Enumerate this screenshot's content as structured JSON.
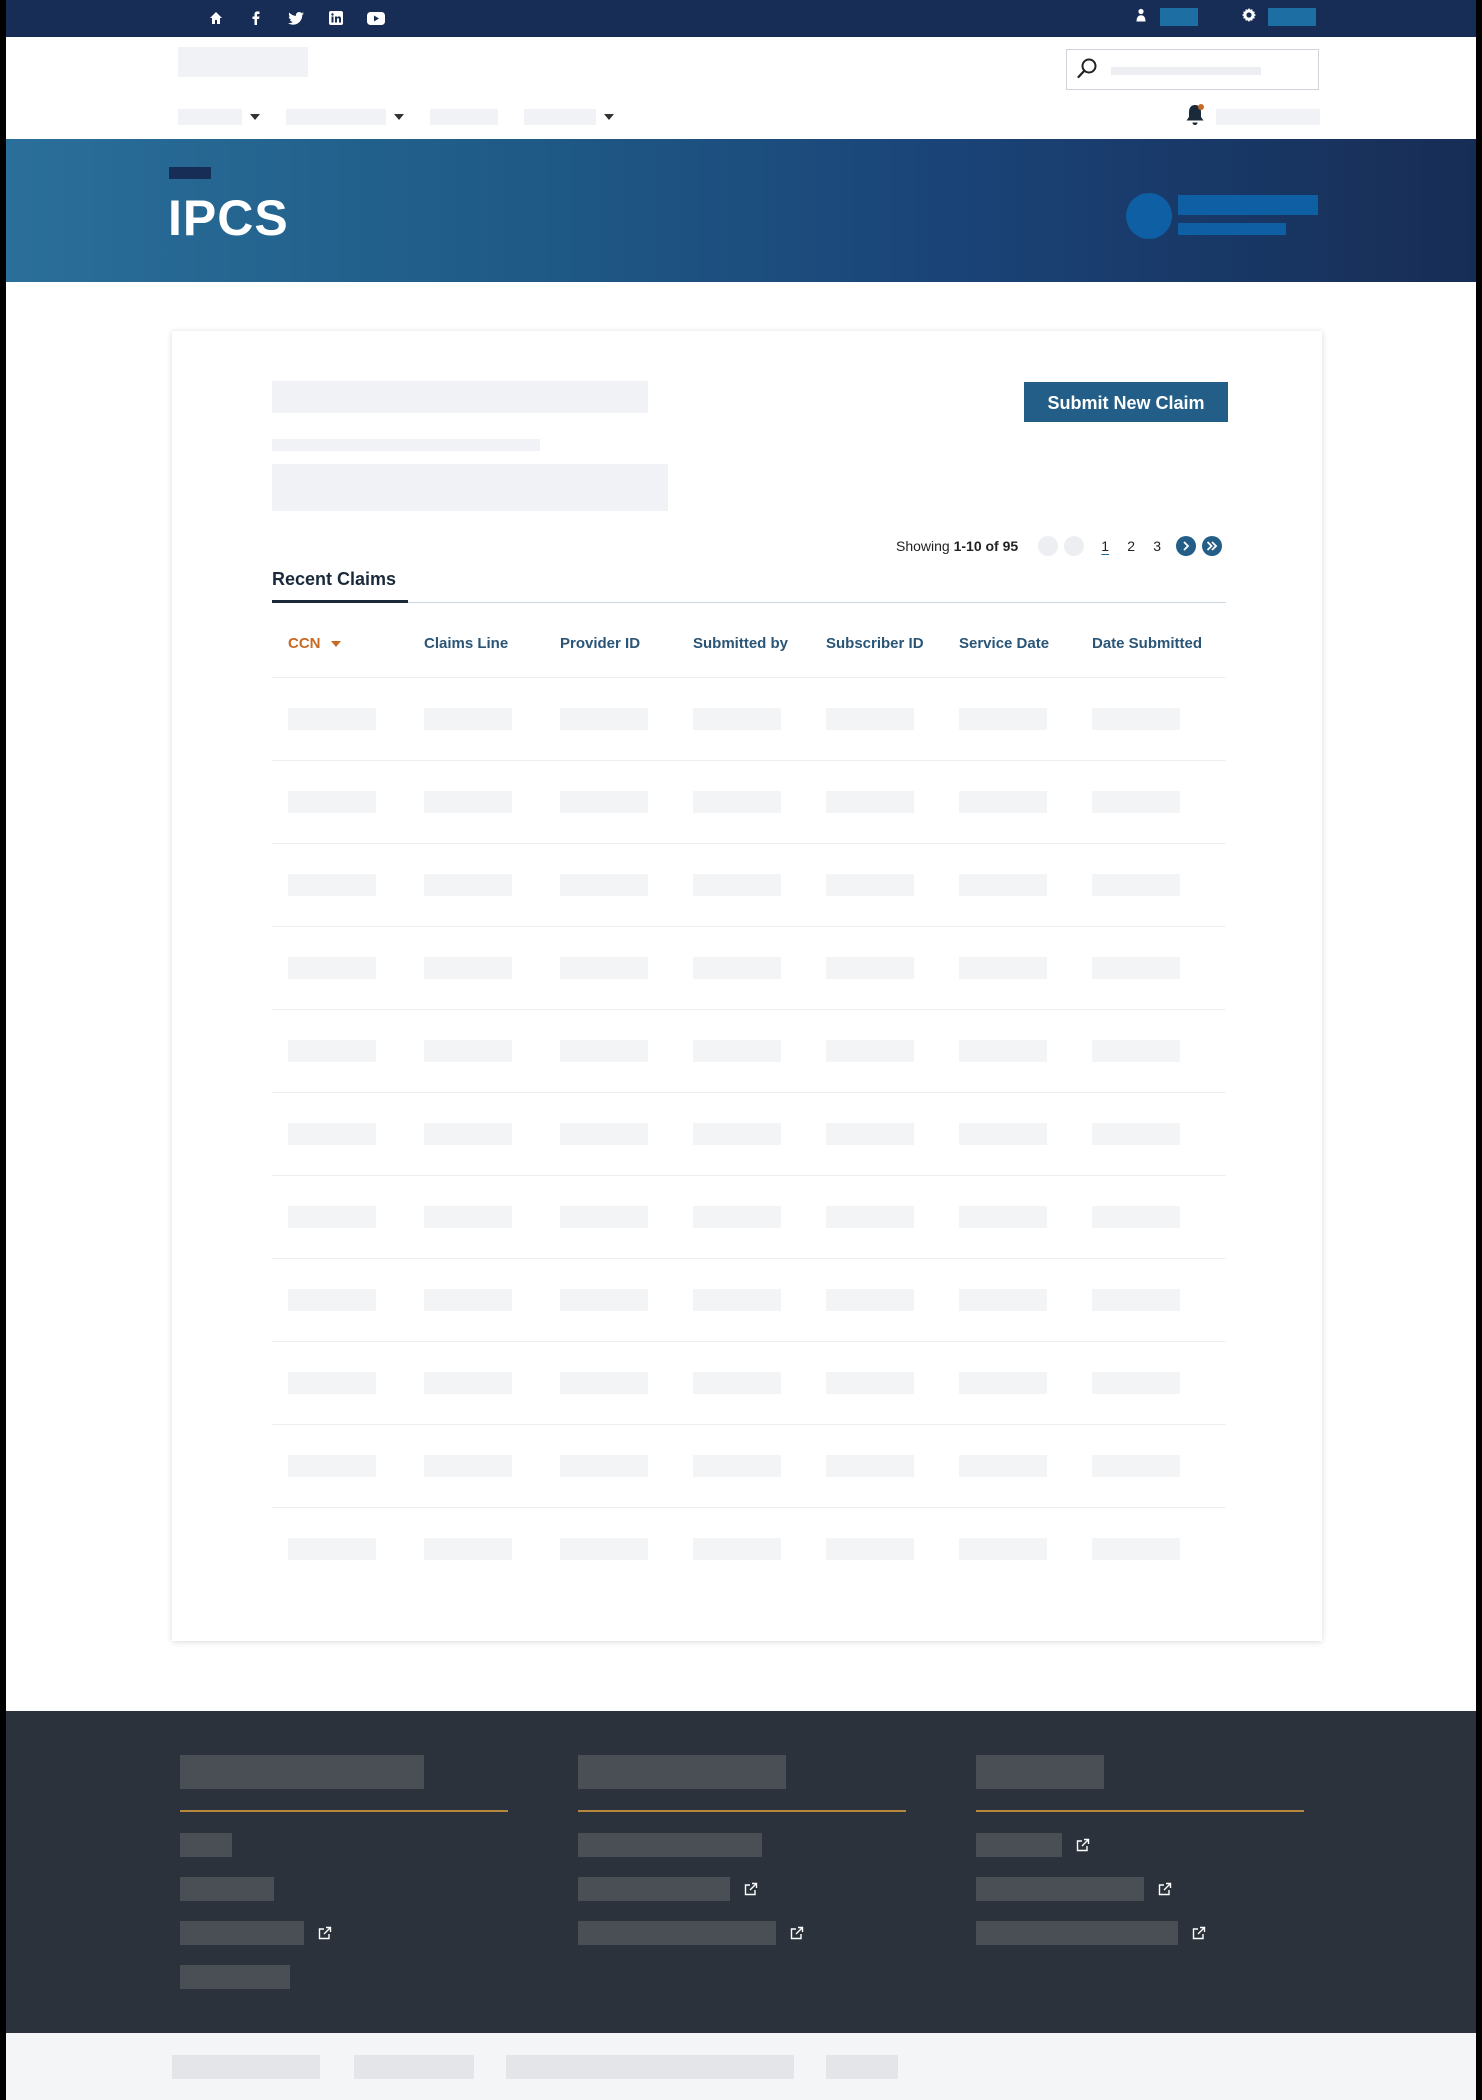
{
  "hero": {
    "title": "IPCS"
  },
  "actions": {
    "submit_label": "Submit New Claim"
  },
  "pagination": {
    "showing_prefix": "Showing ",
    "showing_range": "1-10 of 95",
    "pages": [
      "1",
      "2",
      "3"
    ],
    "current_page": "1"
  },
  "tabs": [
    {
      "label": "Recent Claims",
      "active": true
    }
  ],
  "table": {
    "columns": [
      "CCN",
      "Claims Line",
      "Provider ID",
      "Submitted by",
      "Subscriber ID",
      "Service Date",
      "Date Submitted"
    ],
    "sorted_column": "CCN",
    "row_count": 11
  },
  "colors": {
    "utility_bar": "#172d55",
    "primary_button": "#225e87",
    "sort_accent": "#c76a24",
    "footer": "#2b323b",
    "footer_rule": "#b8873f"
  },
  "icons": {
    "social": [
      "home-icon",
      "facebook-icon",
      "twitter-icon",
      "linkedin-icon",
      "youtube-icon"
    ],
    "utility": [
      "user-icon",
      "gear-icon"
    ],
    "header": [
      "search-icon",
      "bell-icon"
    ]
  }
}
